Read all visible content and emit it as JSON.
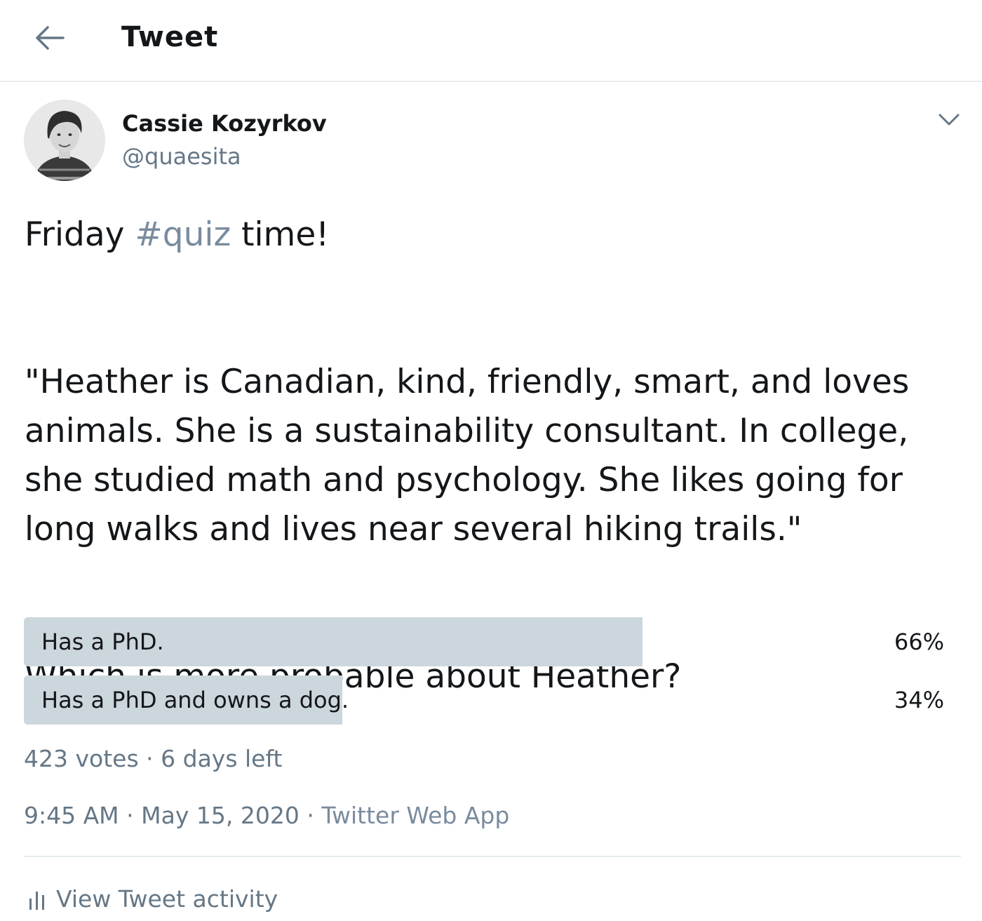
{
  "header": {
    "back_icon": "arrow-left-icon",
    "title": "Tweet"
  },
  "author": {
    "name": "Cassie Kozyrkov",
    "handle": "@quaesita",
    "avatar_icon": "user-avatar",
    "more_icon": "chevron-down-icon"
  },
  "tweet": {
    "line1_pre": "Friday ",
    "hashtag": "#quiz",
    "line1_post": " time!",
    "quote": "\"Heather is Canadian, kind, friendly, smart, and loves animals. She is a sustainability consultant. In college, she studied math and psychology. She likes going for long walks and lives near several hiking trails.\"",
    "question": "Which is more probable about Heather?"
  },
  "poll": {
    "options": [
      {
        "label": "Has a PhD.",
        "percent_text": "66%",
        "percent": 66
      },
      {
        "label": "Has a PhD and owns a dog.",
        "percent_text": "34%",
        "percent": 34
      }
    ],
    "votes": "423 votes",
    "separator": "·",
    "time_left": "6 days left"
  },
  "meta": {
    "time": "9:45 AM",
    "separator": "·",
    "date": "May 15, 2020",
    "source": "Twitter Web App"
  },
  "activity": {
    "icon": "bar-chart-icon",
    "label": "View Tweet activity"
  },
  "colors": {
    "text": "#14171a",
    "secondary": "#657786",
    "link": "#7a8b9e",
    "poll_bar": "#ccd6dd",
    "divider": "#e6ecf0"
  }
}
